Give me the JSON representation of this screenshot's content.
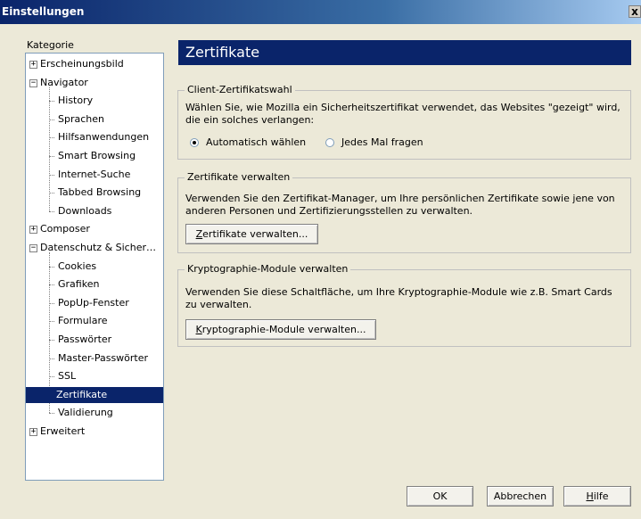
{
  "window": {
    "title": "Einstellungen",
    "close_glyph": "x"
  },
  "kategorie_label": "Kategorie",
  "tree": [
    {
      "label": "Erscheinungsbild",
      "level": 0,
      "expander": "+"
    },
    {
      "label": "Navigator",
      "level": 0,
      "expander": "−"
    },
    {
      "label": "History",
      "level": 1
    },
    {
      "label": "Sprachen",
      "level": 1
    },
    {
      "label": "Hilfsanwendungen",
      "level": 1
    },
    {
      "label": "Smart Browsing",
      "level": 1
    },
    {
      "label": "Internet-Suche",
      "level": 1
    },
    {
      "label": "Tabbed Browsing",
      "level": 1
    },
    {
      "label": "Downloads",
      "level": 1
    },
    {
      "label": "Composer",
      "level": 0,
      "expander": "+"
    },
    {
      "label": "Datenschutz & Sicher…",
      "level": 0,
      "expander": "−"
    },
    {
      "label": "Cookies",
      "level": 1
    },
    {
      "label": "Grafiken",
      "level": 1
    },
    {
      "label": "PopUp-Fenster",
      "level": 1
    },
    {
      "label": "Formulare",
      "level": 1
    },
    {
      "label": "Passwörter",
      "level": 1
    },
    {
      "label": "Master-Passwörter",
      "level": 1
    },
    {
      "label": "SSL",
      "level": 1
    },
    {
      "label": "Zertifikate",
      "level": 1,
      "selected": true
    },
    {
      "label": "Validierung",
      "level": 1
    },
    {
      "label": "Erweitert",
      "level": 0,
      "expander": "+"
    }
  ],
  "panel": {
    "title": "Zertifikate",
    "client": {
      "title": "Client-Zertifikatswahl",
      "text": "Wählen Sie, wie Mozilla ein Sicherheitszertifikat verwendet, das Websites \"gezeigt\" wird, die ein solches verlangen:",
      "option_auto": "Automatisch wählen",
      "option_ask": "Jedes Mal fragen",
      "selected": "auto"
    },
    "manage": {
      "title": "Zertifikate verwalten",
      "text": "Verwenden Sie den Zertifikat-Manager, um Ihre persönlichen Zertifikate sowie jene von anderen Personen und Zertifizierungsstellen zu verwalten.",
      "button_access": "Z",
      "button_rest": "ertifikate verwalten..."
    },
    "crypto": {
      "title": "Kryptographie-Module verwalten",
      "text": "Verwenden Sie diese Schaltfläche, um Ihre Kryptographie-Module wie z.B. Smart Cards zu verwalten.",
      "button_access": "K",
      "button_rest": "ryptographie-Module verwalten..."
    }
  },
  "footer": {
    "ok": "OK",
    "cancel": "Abbrechen",
    "help_access": "H",
    "help_rest": "ilfe"
  }
}
